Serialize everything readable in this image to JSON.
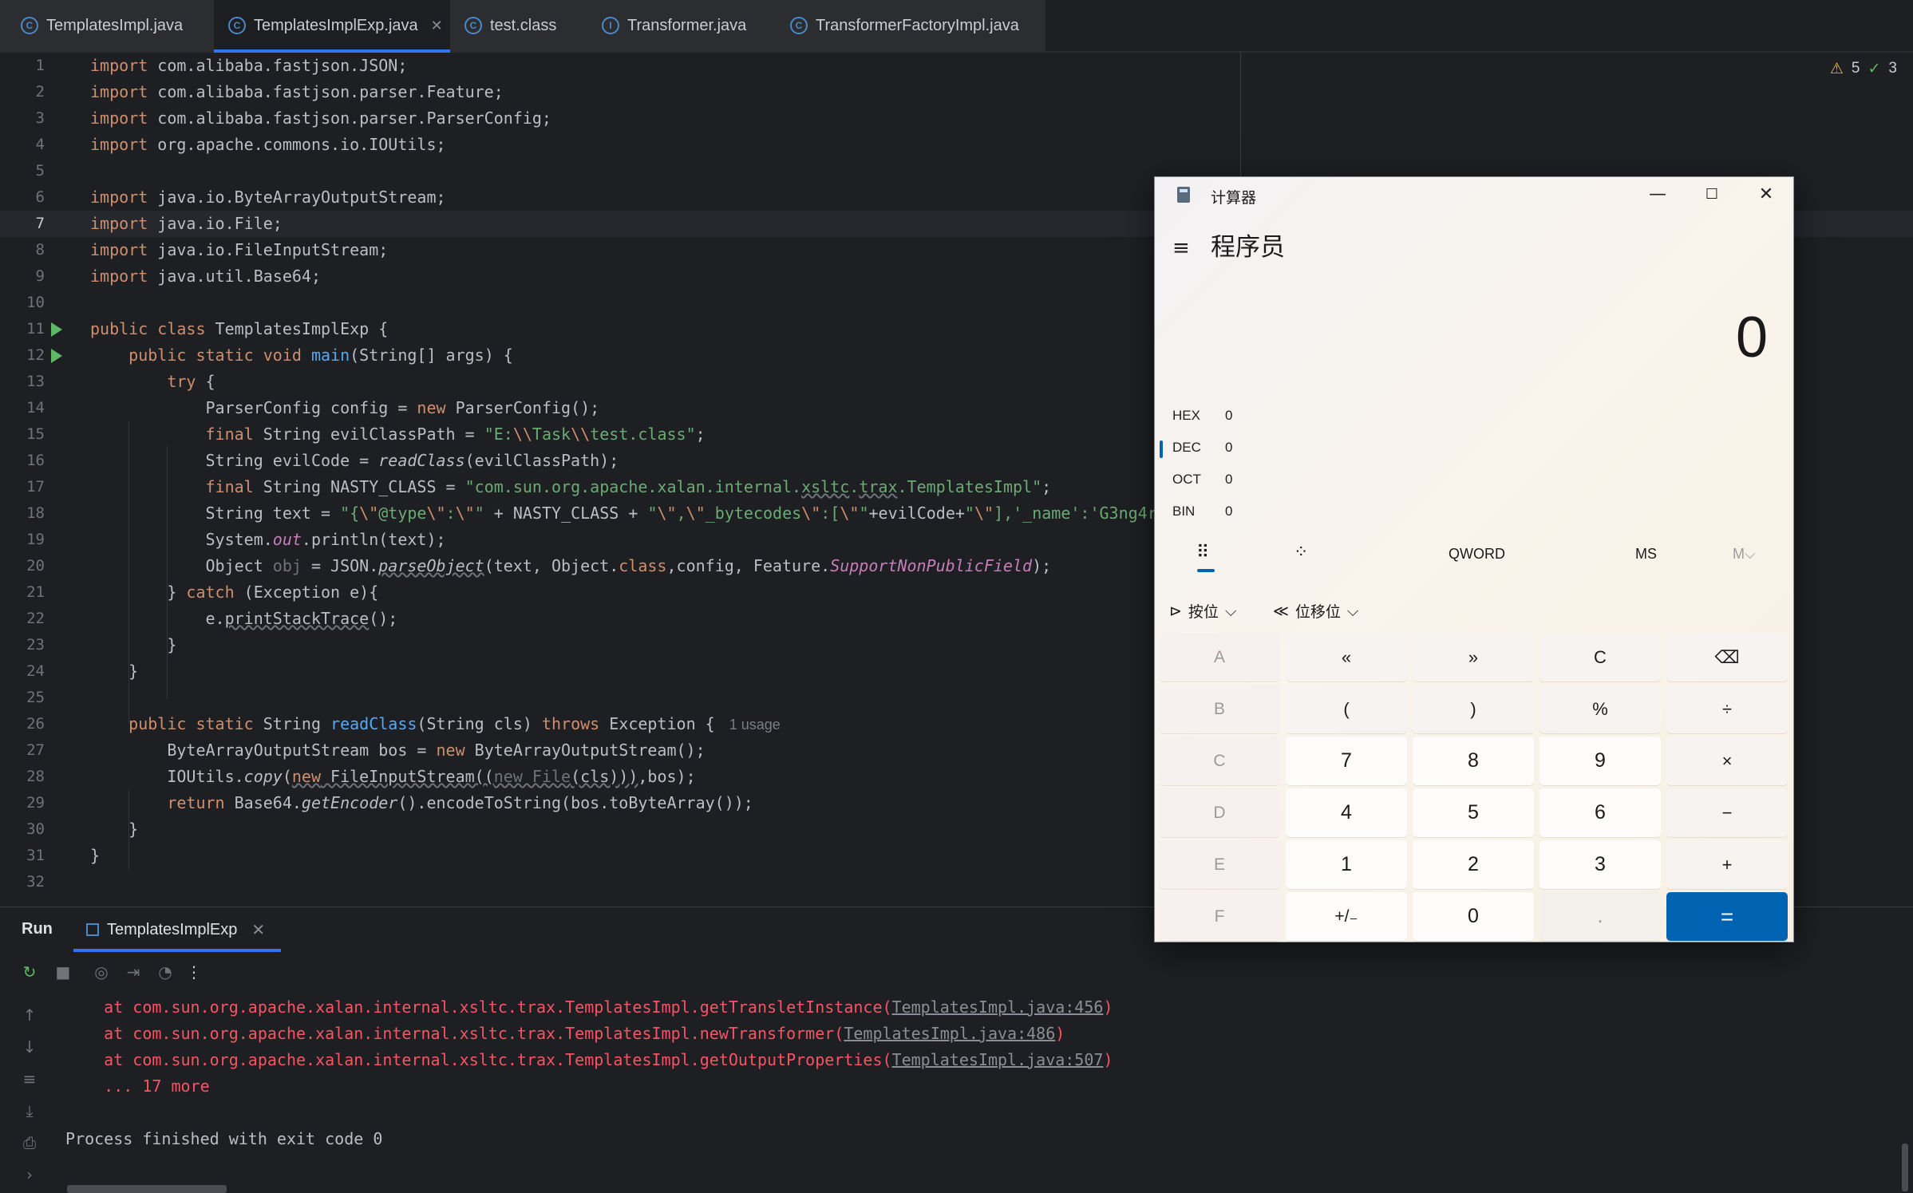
{
  "tabs": [
    {
      "label": "TemplatesImpl.java",
      "active": false,
      "closable": false
    },
    {
      "label": "TemplatesImplExp.java",
      "active": true,
      "closable": true
    },
    {
      "label": "test.class",
      "active": false,
      "closable": false
    },
    {
      "label": "Transformer.java",
      "active": false,
      "closable": false
    },
    {
      "label": "TransformerFactoryImpl.java",
      "active": false,
      "closable": false
    }
  ],
  "inspections": {
    "warnings": "5",
    "ok": "3"
  },
  "editor": {
    "current_line": 7,
    "lines": [
      "1",
      "2",
      "3",
      "4",
      "5",
      "6",
      "7",
      "8",
      "9",
      "10",
      "11",
      "12",
      "13",
      "14",
      "15",
      "16",
      "17",
      "18",
      "19",
      "20",
      "21",
      "22",
      "23",
      "24",
      "25",
      "26",
      "27",
      "28",
      "29",
      "30",
      "31",
      "32"
    ],
    "usage_hint": "1 usage"
  },
  "run": {
    "title": "Run",
    "tab_label": "TemplatesImplExp",
    "output": [
      {
        "prefix": "    at com.sun.org.apache.xalan.internal.xsltc.trax.TemplatesImpl.getTransletInstance(",
        "link": "TemplatesImpl.java:456",
        "suffix": ")"
      },
      {
        "prefix": "    at com.sun.org.apache.xalan.internal.xsltc.trax.TemplatesImpl.newTransformer(",
        "link": "TemplatesImpl.java:486",
        "suffix": ")"
      },
      {
        "prefix": "    at com.sun.org.apache.xalan.internal.xsltc.trax.TemplatesImpl.getOutputProperties(",
        "link": "TemplatesImpl.java:507",
        "suffix": ")"
      },
      {
        "prefix": "    ... 17 more",
        "link": "",
        "suffix": ""
      }
    ],
    "exit_message": "Process finished with exit code 0"
  },
  "calculator": {
    "window_title": "计算器",
    "mode": "程序员",
    "display": "0",
    "radix": [
      {
        "label": "HEX",
        "value": "0"
      },
      {
        "label": "DEC",
        "value": "0"
      },
      {
        "label": "OCT",
        "value": "0"
      },
      {
        "label": "BIN",
        "value": "0"
      }
    ],
    "word_size": "QWORD",
    "memory_store": "MS",
    "memory_menu": "M",
    "bitwise": "按位",
    "bitshift": "位移位",
    "keys": [
      [
        "A",
        "«",
        "»",
        "C",
        "⌫"
      ],
      [
        "B",
        "(",
        ")",
        "%",
        "÷"
      ],
      [
        "C",
        "7",
        "8",
        "9",
        "×"
      ],
      [
        "D",
        "4",
        "5",
        "6",
        "−"
      ],
      [
        "E",
        "1",
        "2",
        "3",
        "+"
      ],
      [
        "F",
        "+/₋",
        "0",
        ".",
        "="
      ]
    ]
  }
}
